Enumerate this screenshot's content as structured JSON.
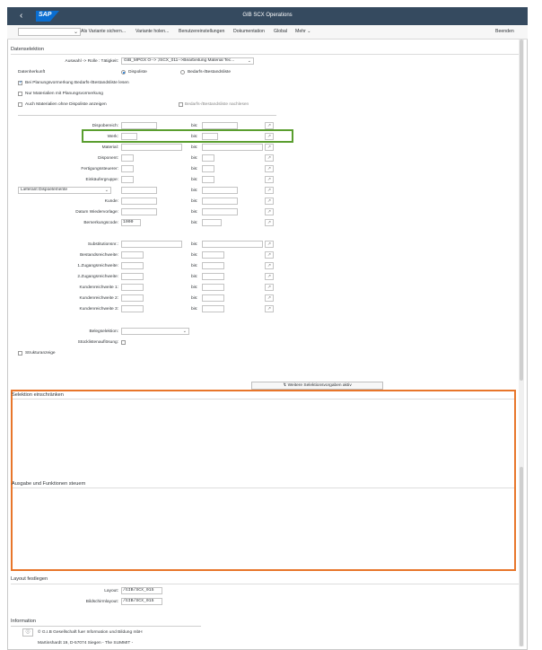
{
  "shell": {
    "back": "‹",
    "logo": "SAP",
    "title": "GIB SCX Operations"
  },
  "toolbar": {
    "items": [
      "Als Variante sichern...",
      "Variante holen...",
      "Benutzereinstellungen",
      "Dokumentation",
      "Global",
      "Mehr ⌄"
    ],
    "exit": "Beenden"
  },
  "section1": {
    "title": "Datenselektion",
    "role_label": "Auswahl -> Rolle : Tätigkeit:",
    "role_value": "GIB_MPGX O--> ;/SCX_011-->Bearbeitung Material Tec...",
    "datenherkunft_label": "Datenherkunft",
    "radio1": "Dispoliste",
    "radio2": "Bedarfs-/Bestandsliste",
    "cb1": "Bei Planungsvormerkung Bedarfs-/Bestandsliste lesen",
    "cb2": "Nur Materialien mit Planungsvormerkung",
    "cb3": "Auch Materialien ohne Dispoliste anzeigen",
    "cb4": "Bedarfs-/Bestandsliste nachlesen",
    "bis": "bis:",
    "fields": [
      "Dispobereich:",
      "Werk:",
      "Material:",
      "Disponent:",
      "Fertigungssteuerer:",
      "Einkäufergruppe:",
      "Lieferant Dispoelemente",
      "Kunde:",
      "Datum Wiedervorlage:",
      "Bemerkungscode:"
    ],
    "bemerkungscode_value": "1000",
    "fields2": [
      "Substitutionsnr.:",
      "Bestandsreichweite:",
      "1.Zugangsreichweite:",
      "2.Zugangsreichweite:",
      "Kundenreichweite 1:",
      "Kundenreichweite 2:",
      "Kundenreichweite 3:"
    ],
    "belegselektion": "Belegselektion:",
    "stuecklisten": "Stücklistenauflösung:",
    "struktur": "Strukturanzeige",
    "more_button": "↯ Weitere Selektionsvorgaben aktiv"
  },
  "section2": {
    "title": "Selektion einschränken"
  },
  "section3": {
    "title": "Ausgabe und Funktionen steuern"
  },
  "section4": {
    "title": "Layout festlegen",
    "layout_label": "Layout:",
    "layout_value": "/GIB/SCX_015",
    "screen_label": "Bildschirmlayout:",
    "screen_value": "/GIB/SCX_015"
  },
  "section5": {
    "title": "Information",
    "line1": "© G.I.B Gesellschaft fuer Information und Bildung mbH",
    "line2": "Martinshardt 19, D-57074 Siegen - The SUMMIT -"
  },
  "mselect_icon": "multiple-selection-icon",
  "colors": {
    "shell": "#354a5f",
    "green": "#5a9e2f",
    "orange": "#e8762b"
  }
}
